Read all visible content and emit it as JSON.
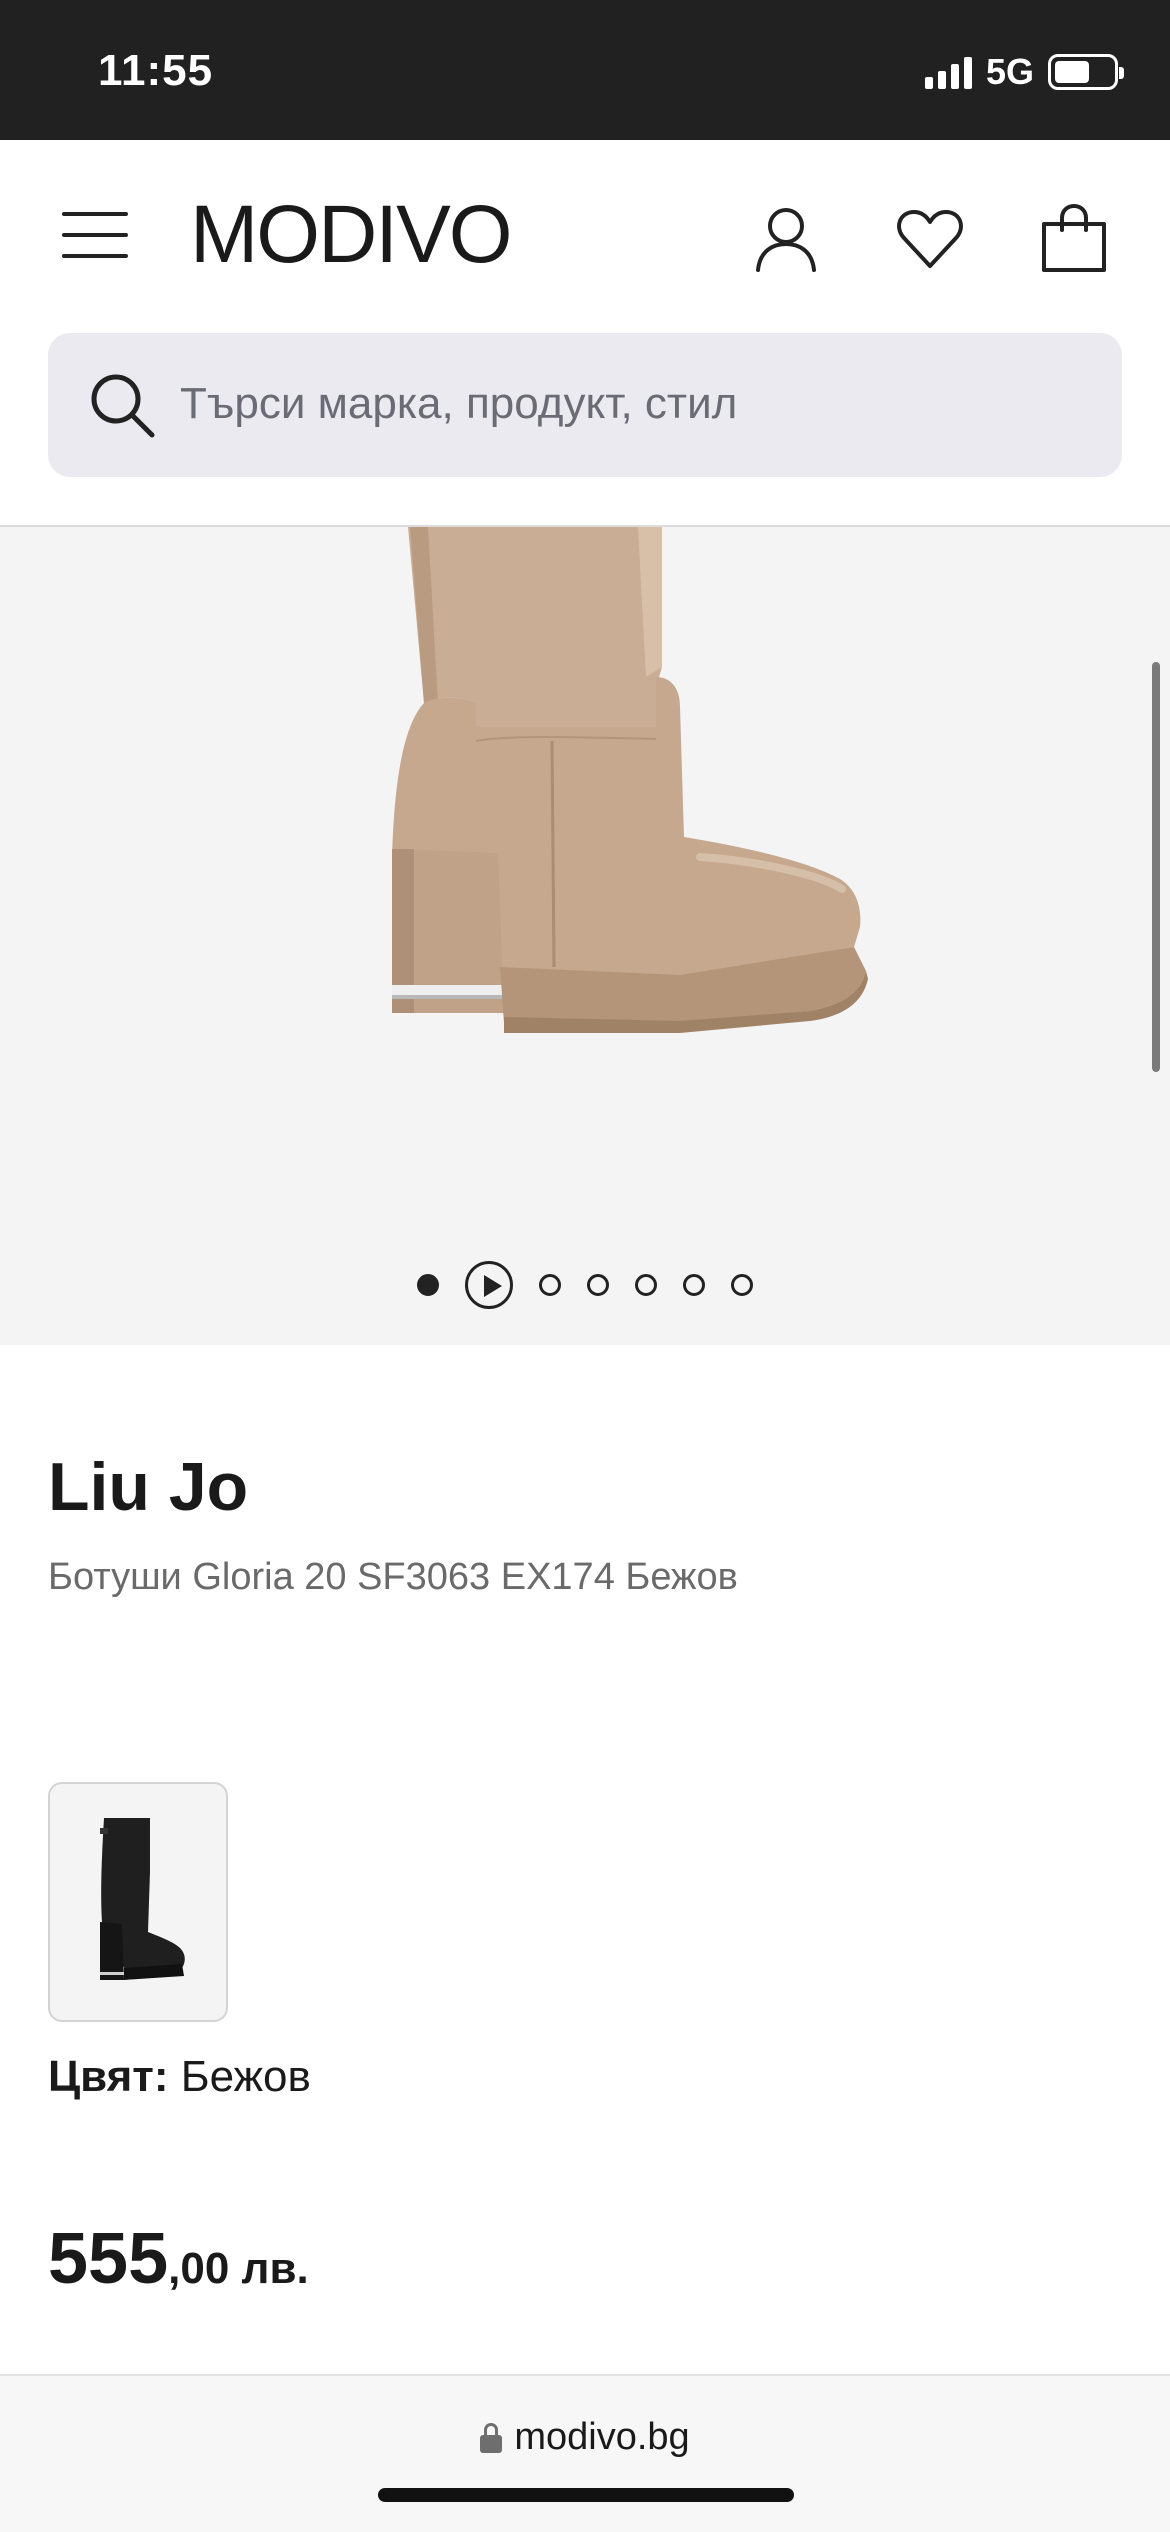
{
  "status_bar": {
    "time": "11:55",
    "network": "5G"
  },
  "header": {
    "logo": "MODIVO",
    "icons": [
      "menu-icon",
      "user-icon",
      "heart-icon",
      "shopping-bag-icon"
    ]
  },
  "search": {
    "placeholder": "Търси марка, продукт, стил"
  },
  "gallery": {
    "image_count": 7,
    "active_index": 0,
    "has_video": true
  },
  "product": {
    "brand": "Liu Jo",
    "name": "Ботуши Gloria 20 SF3063 EX174 Бежов",
    "color_label": "Цвят:",
    "color_value": "Бежов",
    "price_main": "555",
    "price_rest": ",00 лв."
  },
  "browser": {
    "url": "modivo.bg"
  },
  "colors": {
    "status_bar_bg": "#212121",
    "search_bg": "#ebeaf0",
    "gallery_bg": "#f4f4f4",
    "boot_beige": "#c9ad94"
  }
}
